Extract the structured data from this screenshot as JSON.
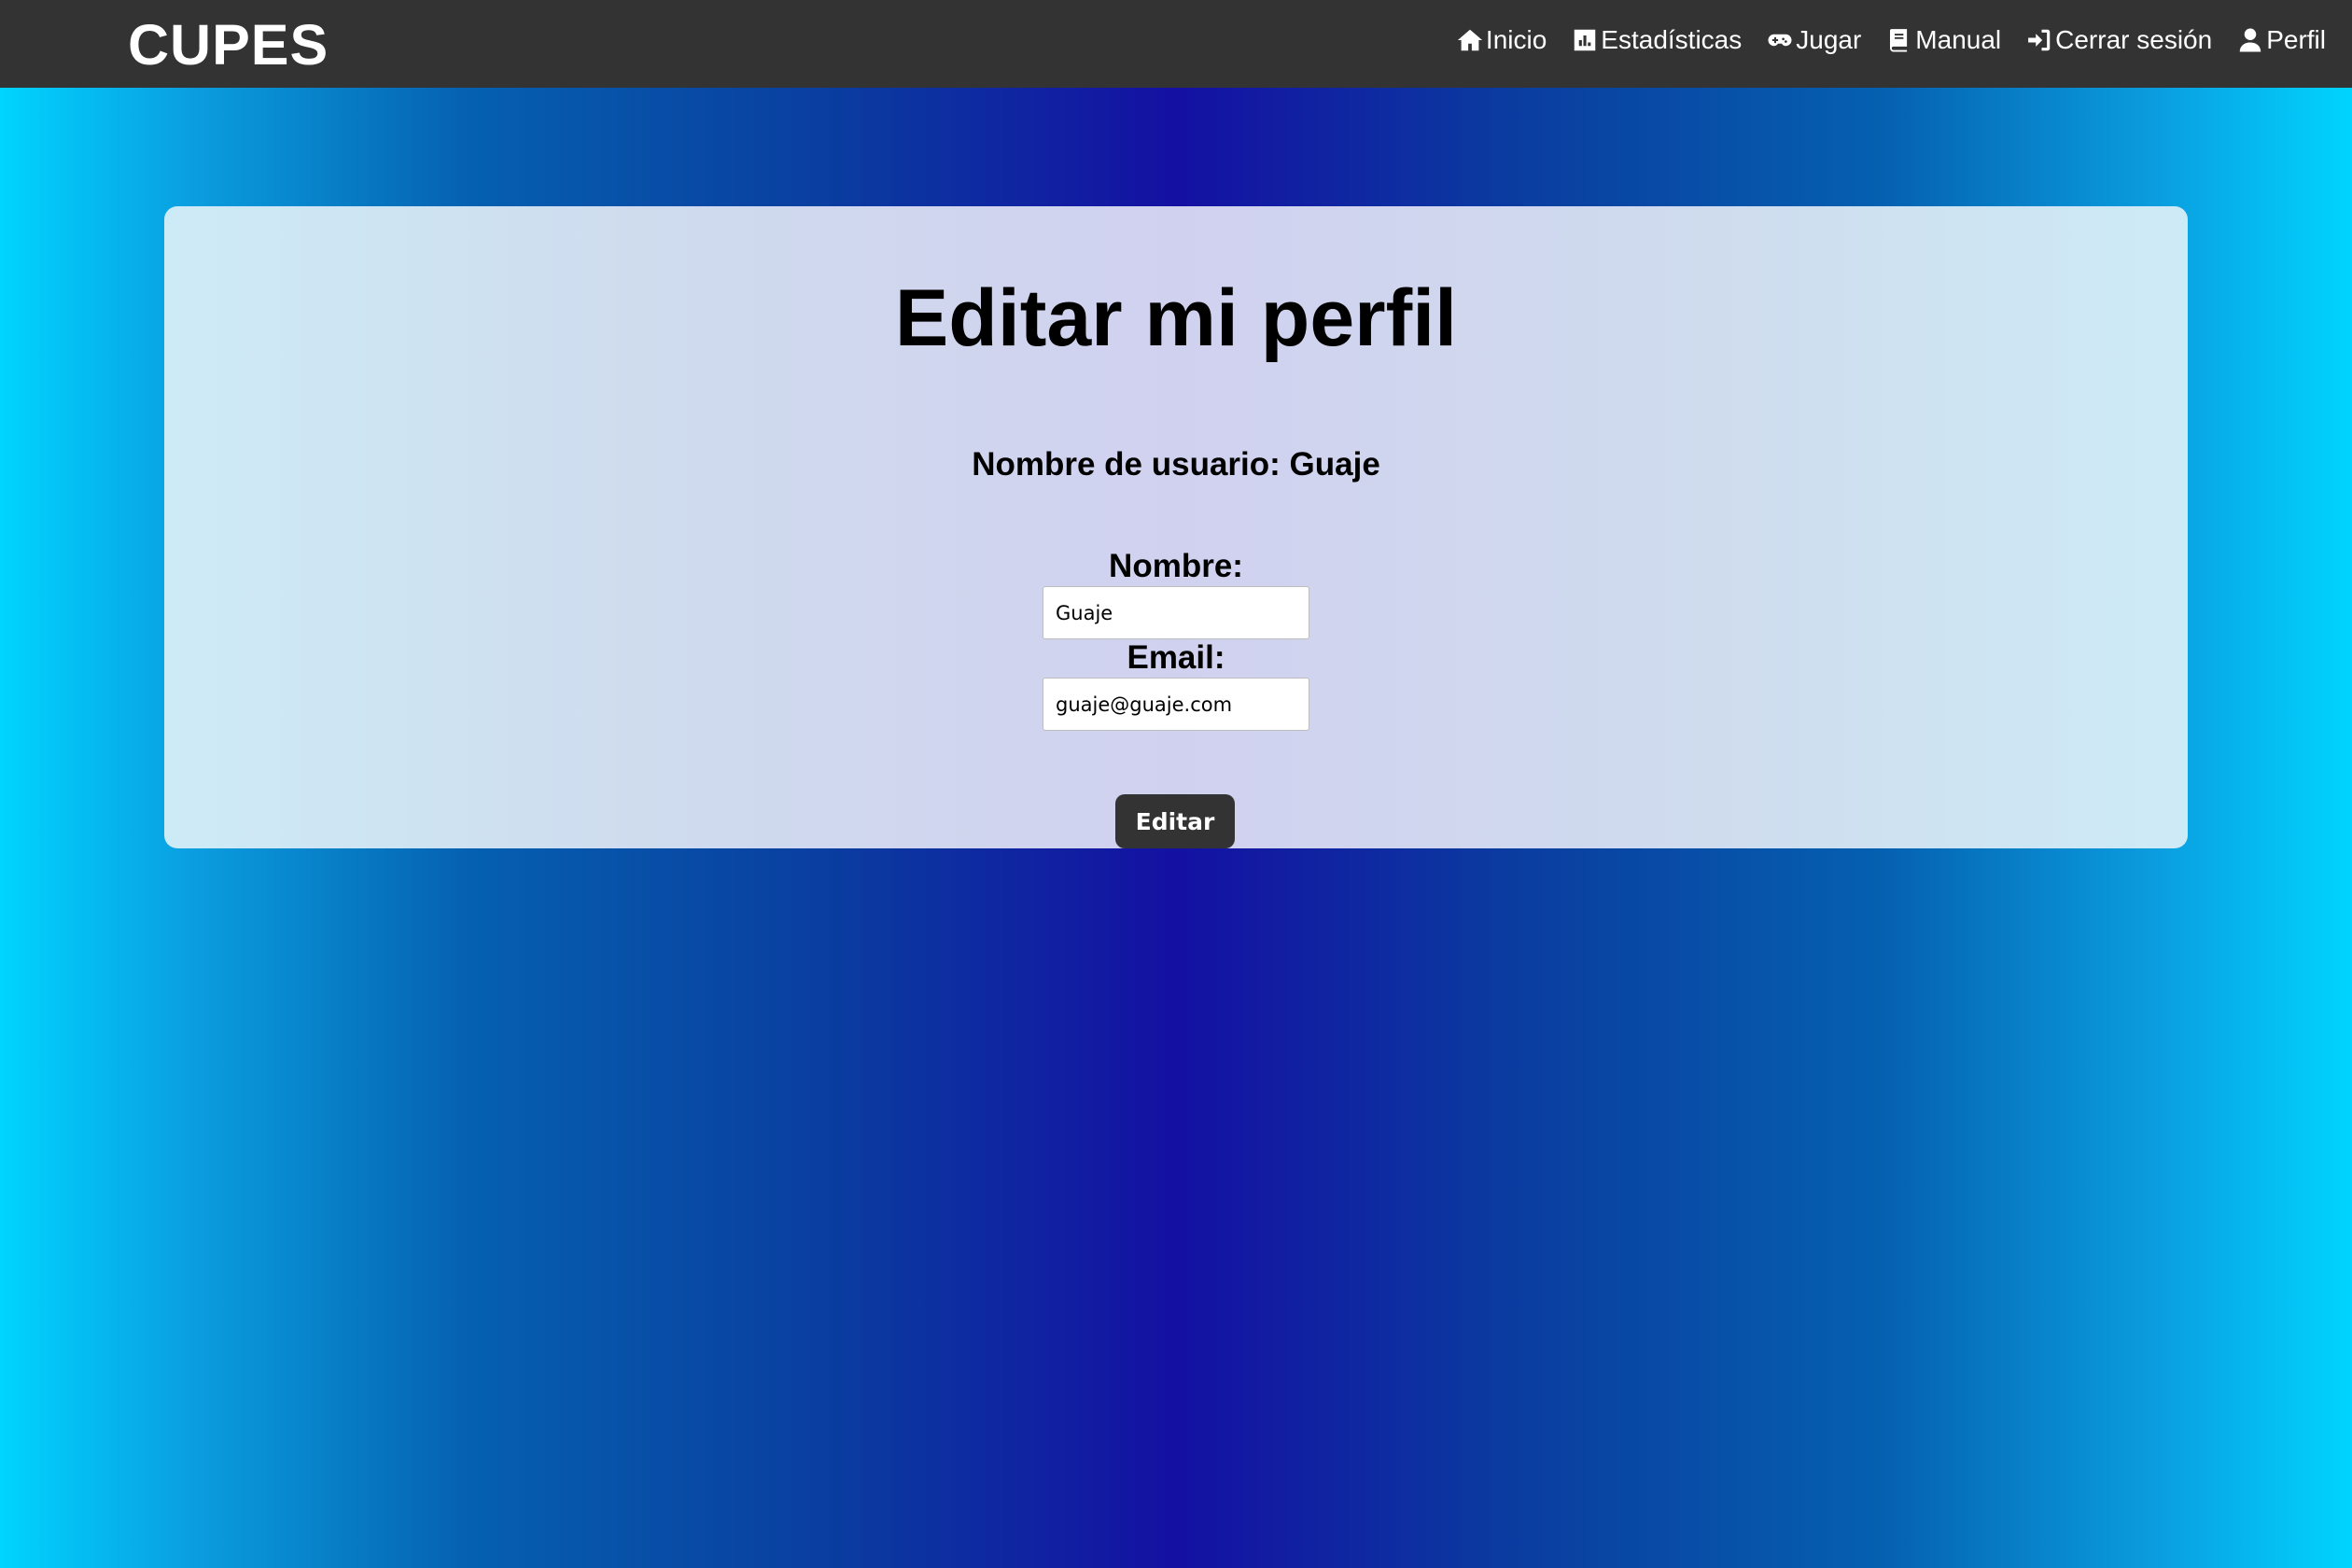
{
  "navbar": {
    "brand": "CUPES",
    "items": [
      {
        "label": "Inicio",
        "icon": "home-icon"
      },
      {
        "label": "Estadísticas",
        "icon": "chart-icon"
      },
      {
        "label": "Jugar",
        "icon": "gamepad-icon"
      },
      {
        "label": "Manual",
        "icon": "book-icon"
      },
      {
        "label": "Cerrar sesión",
        "icon": "sign-in-icon"
      },
      {
        "label": "Perfil",
        "icon": "user-icon"
      }
    ]
  },
  "profile": {
    "title": "Editar mi perfil",
    "username_line": "Nombre de usuario: Guaje",
    "nombre_label": "Nombre:",
    "nombre_value": "Guaje",
    "email_label": "Email:",
    "email_value": "guaje@guaje.com",
    "submit_label": "Editar"
  },
  "colors": {
    "navbar_bg": "#333333",
    "gradient_edge": "#00d4ff",
    "gradient_center": "#1410a2",
    "button_bg": "#333333"
  }
}
